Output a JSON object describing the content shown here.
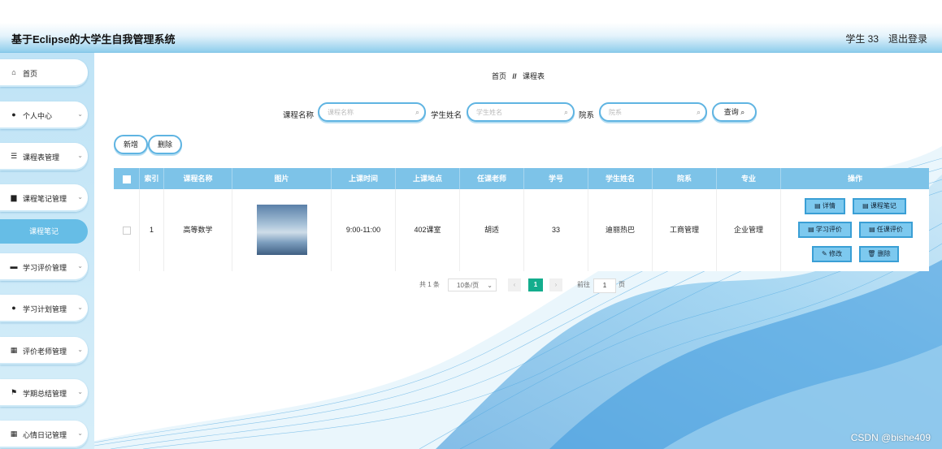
{
  "header": {
    "title": "基于Eclipse的大学生自我管理系统",
    "user": "学生 33",
    "logout": "退出登录"
  },
  "sidebar": {
    "items": [
      {
        "label": "首页",
        "icon": "home-icon"
      },
      {
        "label": "个人中心",
        "icon": "user-icon"
      },
      {
        "label": "课程表管理",
        "icon": "list-icon"
      },
      {
        "label": "课程笔记管理",
        "icon": "briefcase-icon"
      },
      {
        "label": "学习评价管理",
        "icon": "monitor-icon"
      },
      {
        "label": "学习计划管理",
        "icon": "user-icon"
      },
      {
        "label": "评价老师管理",
        "icon": "grid-icon"
      },
      {
        "label": "学期总结管理",
        "icon": "flag-icon"
      },
      {
        "label": "心情日记管理",
        "icon": "grid-icon"
      }
    ],
    "active_sub": "课程笔记"
  },
  "breadcrumb": {
    "home": "首页",
    "sep": "//",
    "current": "课程表"
  },
  "search": {
    "course_label": "课程名称",
    "course_placeholder": "课程名称",
    "student_label": "学生姓名",
    "student_placeholder": "学生姓名",
    "dept_label": "院系",
    "dept_placeholder": "院系",
    "query_button": "查询"
  },
  "toolbar": {
    "add": "新增",
    "delete": "删除"
  },
  "table": {
    "headers": [
      "索引",
      "课程名称",
      "图片",
      "上课时间",
      "上课地点",
      "任课老师",
      "学号",
      "学生姓名",
      "院系",
      "专业",
      "操作"
    ],
    "rows": [
      {
        "index": "1",
        "course": "高等数学",
        "time": "9:00-11:00",
        "place": "402课室",
        "teacher": "胡适",
        "student_no": "33",
        "student_name": "迪丽热巴",
        "dept": "工商管理",
        "major": "企业管理"
      }
    ],
    "actions": {
      "detail": "详情",
      "notes": "课程笔记",
      "study_eval": "学习评价",
      "teacher_eval": "任课评价",
      "edit": "修改",
      "delete": "删除"
    }
  },
  "pagination": {
    "total": "共 1 条",
    "page_size": "10条/页",
    "current_page": "1",
    "goto_label": "前往",
    "goto_value": "1",
    "page_unit": "页"
  },
  "watermark": "CSDN @bishe409",
  "colors": {
    "accent": "#7dc3e8",
    "sidebar_active": "#66bde6",
    "pager_active": "#13ad8d"
  }
}
